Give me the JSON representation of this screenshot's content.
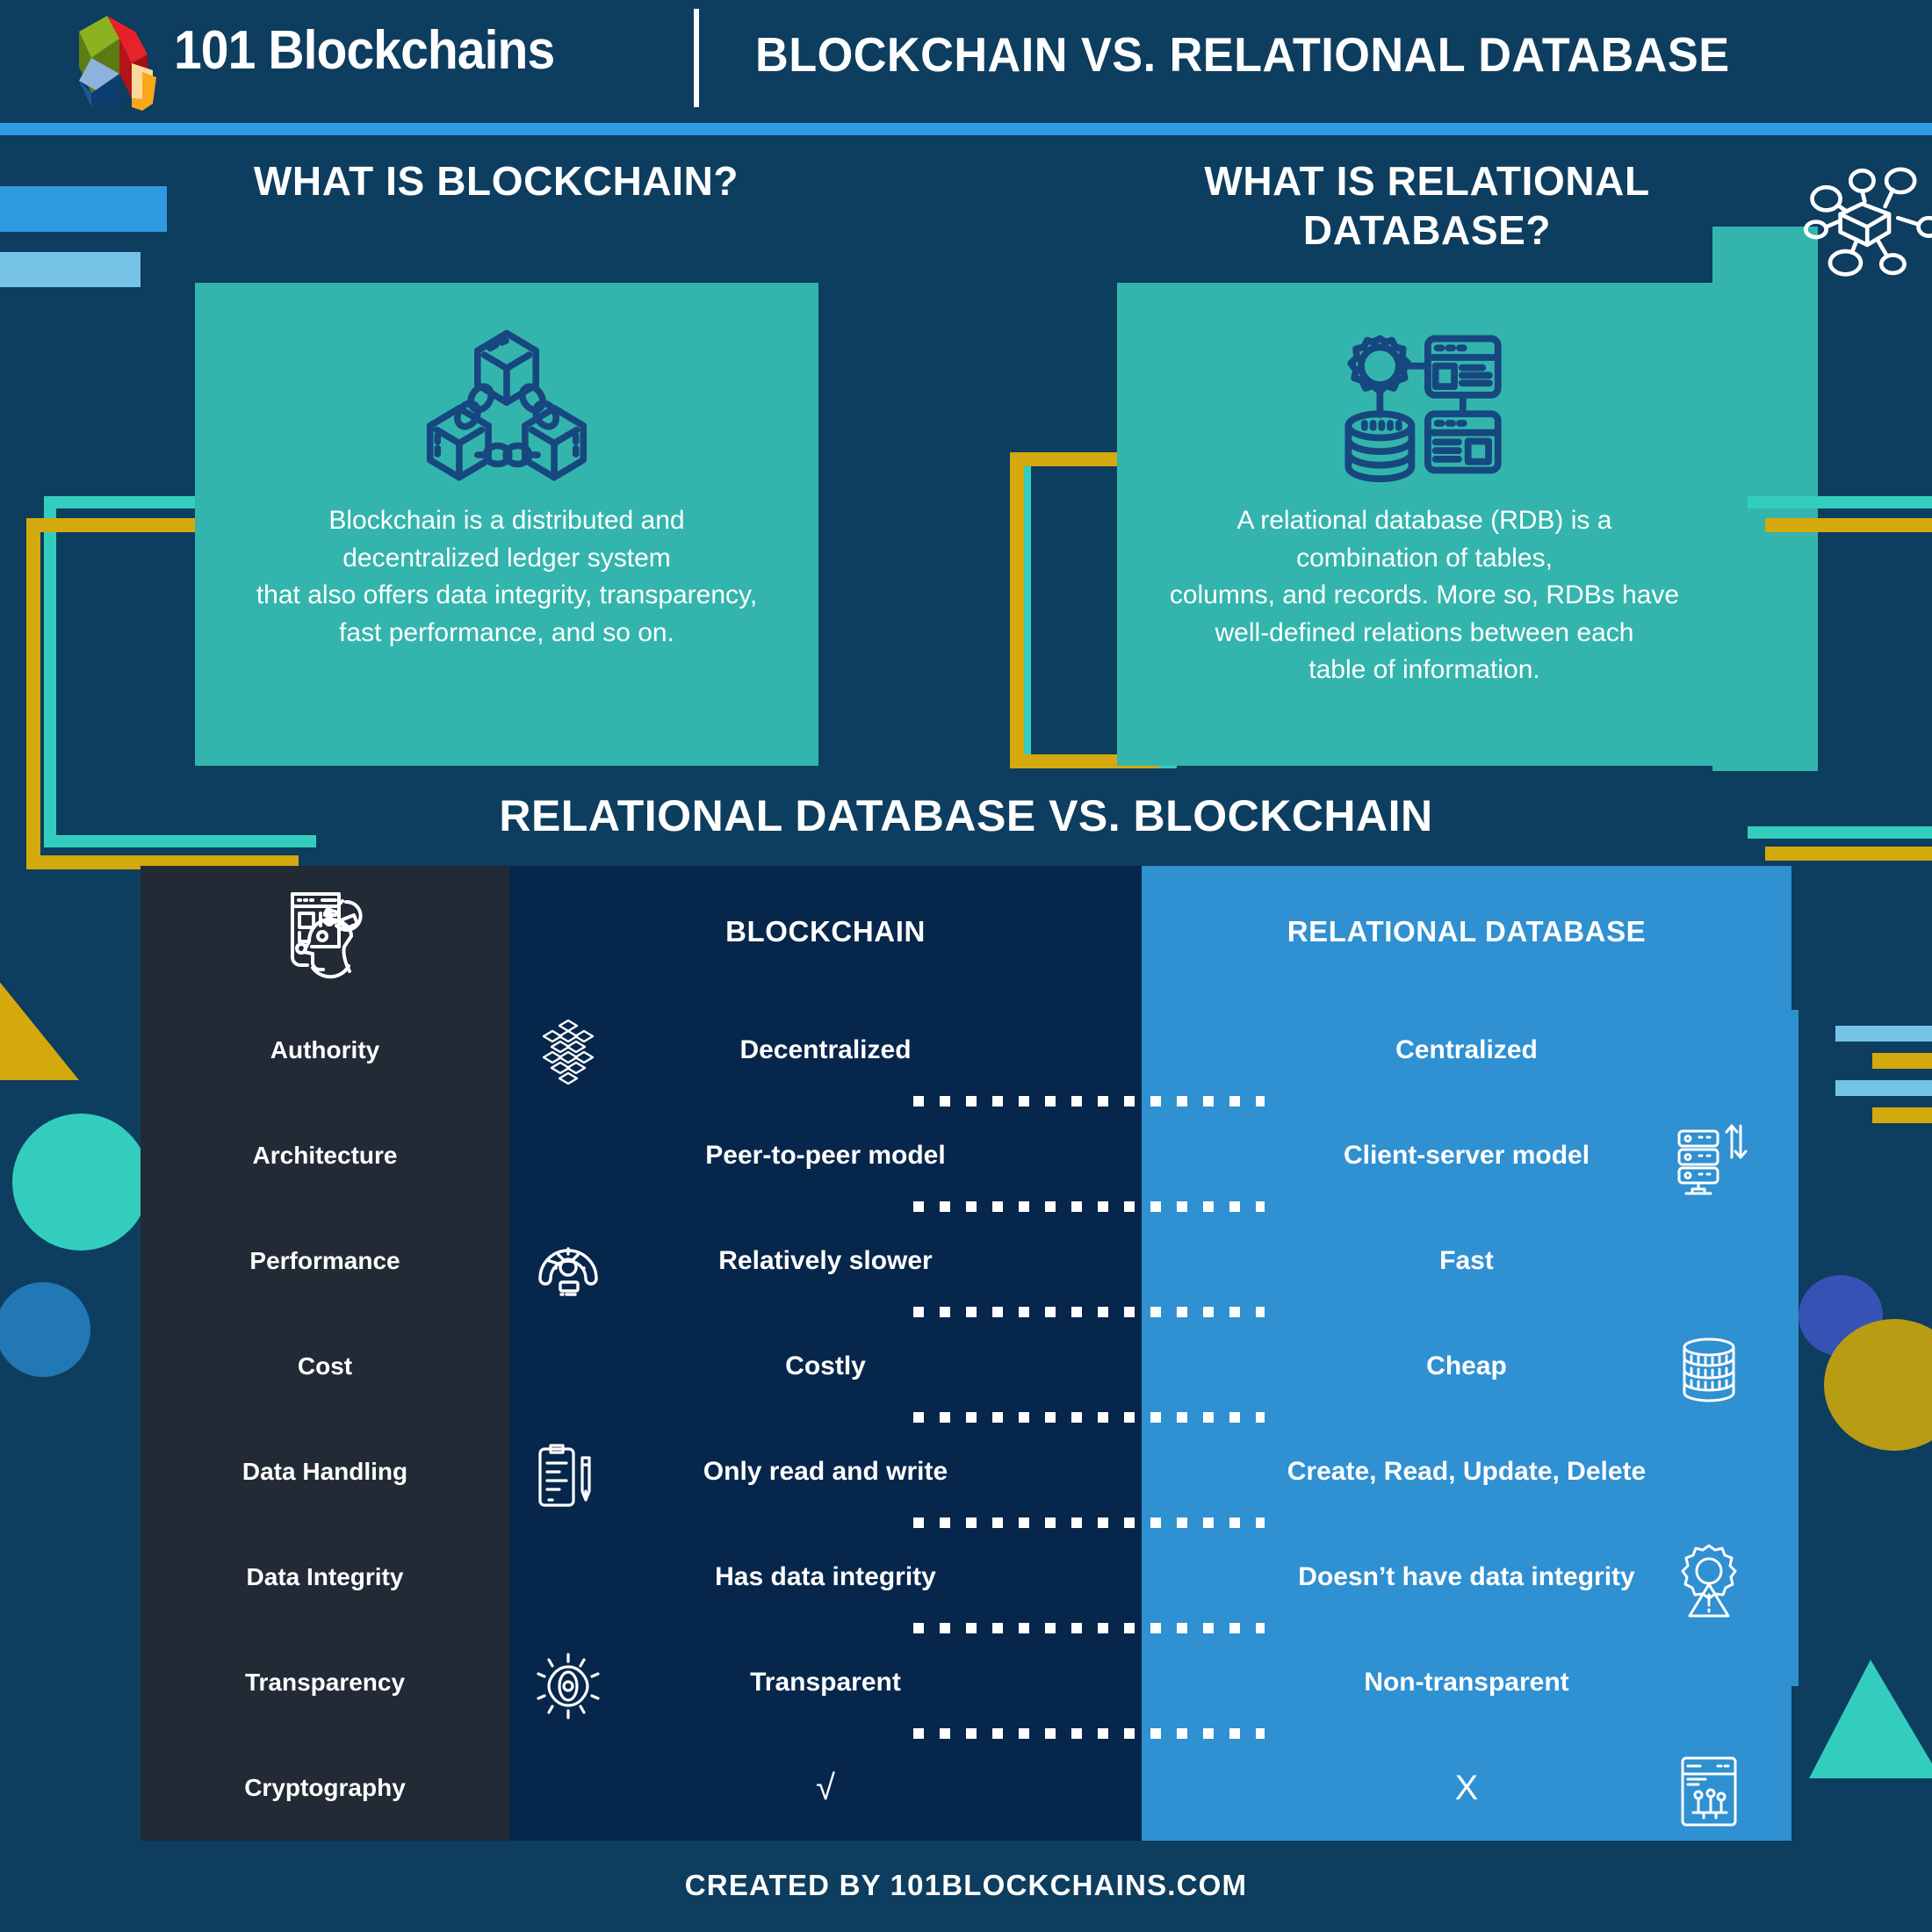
{
  "header": {
    "brand": "101 Blockchains",
    "title": "BLOCKCHAIN VS. RELATIONAL DATABASE",
    "accent_color": "#2f9ae0"
  },
  "sections": {
    "left": {
      "heading": "WHAT IS BLOCKCHAIN?",
      "icon": "blockchain-cubes-icon",
      "body": "Blockchain is a distributed and\ndecentralized ledger system\nthat also offers data integrity, transparency,\nfast performance, and so on."
    },
    "right": {
      "heading": "WHAT IS RELATIONAL\nDATABASE?",
      "icon": "database-server-icon",
      "body": "A relational database (RDB) is a\ncombination of tables,\ncolumns, and records. More so, RDBs have\nwell-defined relations between each\ntable of information."
    }
  },
  "comparison": {
    "title": "RELATIONAL DATABASE VS. BLOCKCHAIN",
    "feature_head_icon": "head-idea-icon",
    "columns": [
      "",
      "BLOCKCHAIN",
      "RELATIONAL DATABASE"
    ],
    "rows": [
      {
        "feature": "Authority",
        "blockchain": "Decentralized",
        "relational": "Centralized",
        "bc_icon": "network-nodes-icon",
        "rdb_icon": ""
      },
      {
        "feature": "Architecture",
        "blockchain": "Peer-to-peer model",
        "relational": "Client-server model",
        "bc_icon": "",
        "rdb_icon": "server-rack-icon"
      },
      {
        "feature": "Performance",
        "blockchain": "Relatively slower",
        "relational": "Fast",
        "bc_icon": "speedometer-icon",
        "rdb_icon": ""
      },
      {
        "feature": "Cost",
        "blockchain": "Costly",
        "relational": "Cheap",
        "bc_icon": "",
        "rdb_icon": "coins-stack-icon"
      },
      {
        "feature": "Data Handling",
        "blockchain": "Only read and write",
        "relational": "Create, Read, Update, Delete",
        "bc_icon": "clipboard-pen-icon",
        "rdb_icon": ""
      },
      {
        "feature": "Data Integrity",
        "blockchain": "Has data integrity",
        "relational": "Doesn’t have data integrity",
        "bc_icon": "",
        "rdb_icon": "alert-gear-icon"
      },
      {
        "feature": "Transparency",
        "blockchain": "Transparent",
        "relational": "Non-transparent",
        "bc_icon": "eye-icon",
        "rdb_icon": ""
      },
      {
        "feature": "Cryptography",
        "blockchain": "√",
        "relational": "X",
        "bc_icon": "",
        "rdb_icon": "circuit-window-icon"
      }
    ]
  },
  "footer": {
    "text": "CREATED BY 101BLOCKCHAINS.COM"
  },
  "palette": {
    "background": "#0d3d5f",
    "card_teal": "#33b5ad",
    "col_feature": "#222a35",
    "col_blockchain": "#07264b",
    "col_relational": "#2f90d2",
    "gold": "#d4a90d",
    "bright_teal": "#33cdbe",
    "light_blue": "#76c3e8",
    "icon_navy": "#17477f"
  }
}
